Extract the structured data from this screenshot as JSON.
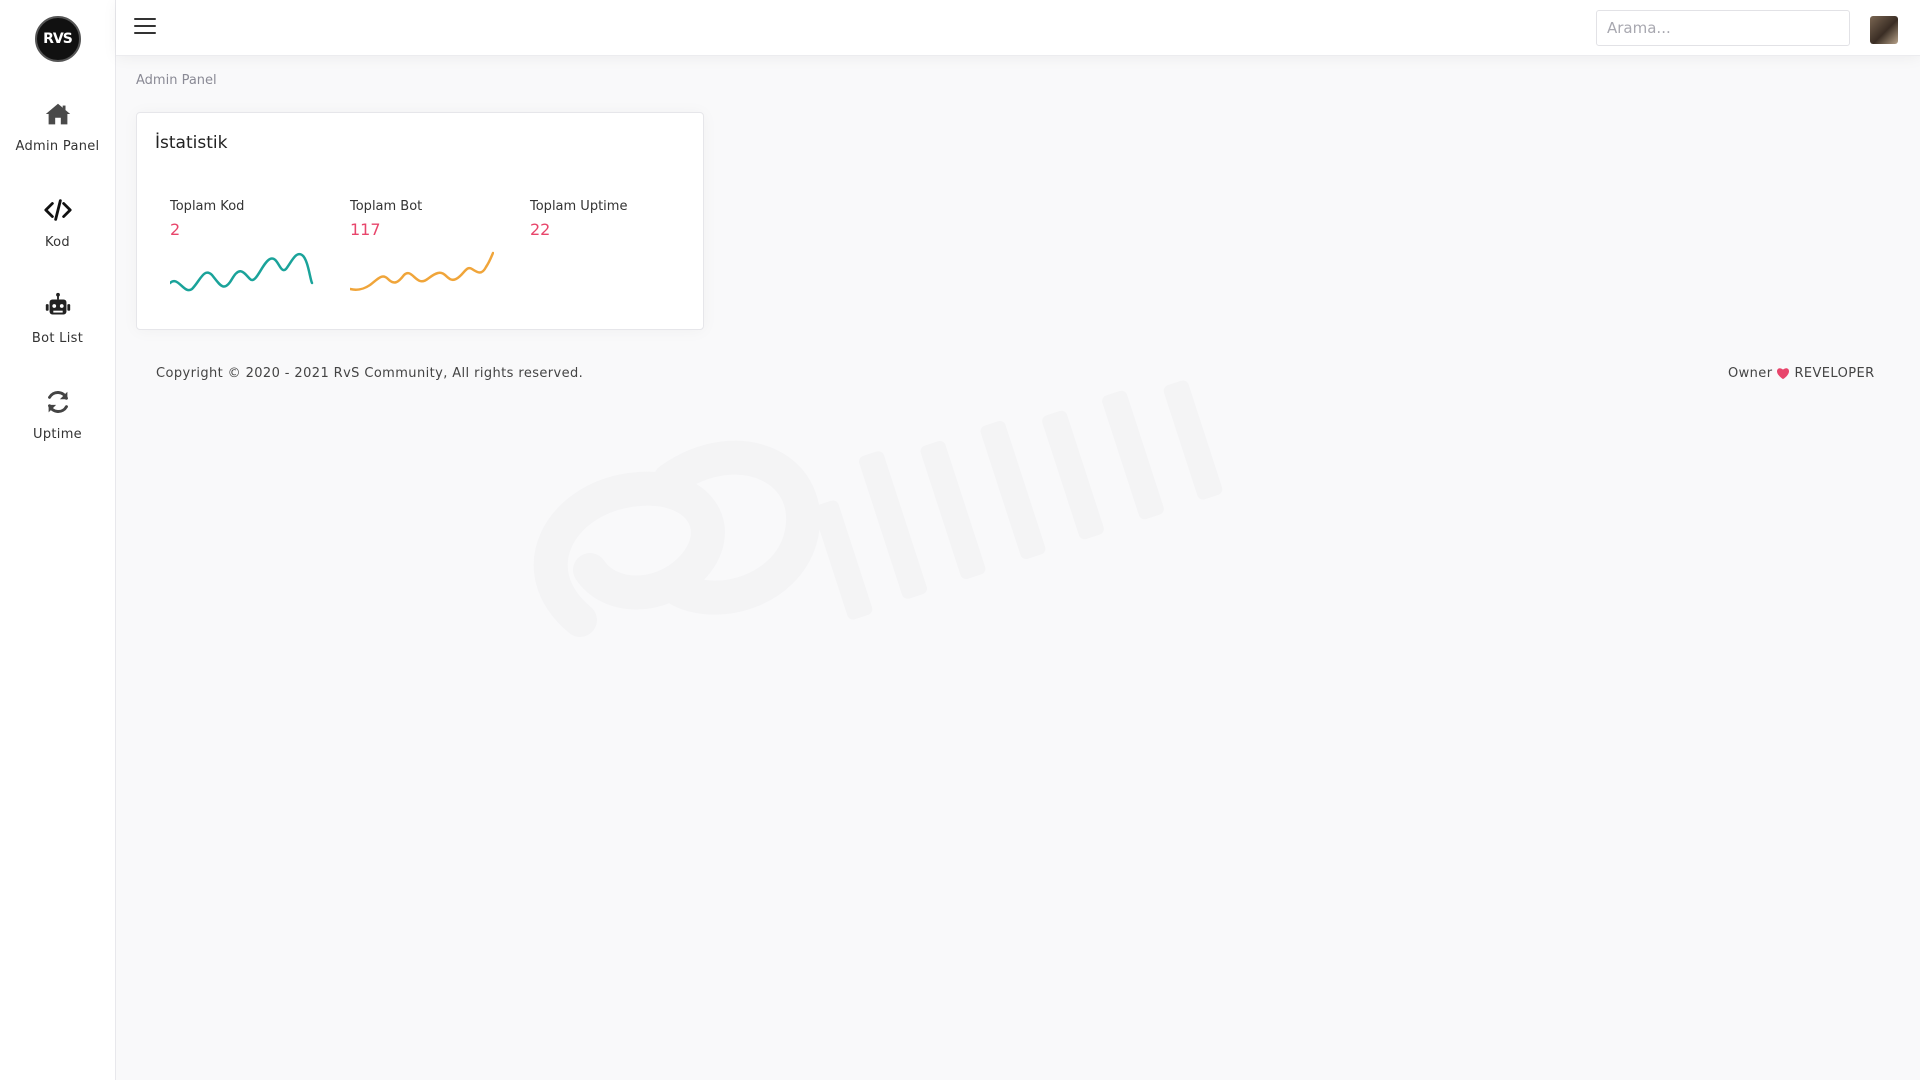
{
  "logo": {
    "text": "RVS"
  },
  "sidebar": {
    "items": [
      {
        "label": "Admin Panel",
        "icon": "home-icon"
      },
      {
        "label": "Kod",
        "icon": "code-icon"
      },
      {
        "label": "Bot List",
        "icon": "robot-icon"
      },
      {
        "label": "Uptime",
        "icon": "refresh-icon"
      }
    ]
  },
  "header": {
    "search_placeholder": "Arama..."
  },
  "breadcrumb": "Admin Panel",
  "stats_card": {
    "title": "İstatistik",
    "stats": [
      {
        "label": "Toplam Kod",
        "value": "2",
        "sparkline_color": "#1aa39a"
      },
      {
        "label": "Toplam Bot",
        "value": "117",
        "sparkline_color": "#f0a53a"
      },
      {
        "label": "Toplam Uptime",
        "value": "22"
      }
    ]
  },
  "footer": {
    "copyright": "Copyright © 2020 - 2021 RvS Community, All rights reserved.",
    "owner_prefix": "Owner",
    "owner_name": "REVELOPER"
  },
  "colors": {
    "accent_value": "#e8456b",
    "heart": "#e8456b"
  }
}
